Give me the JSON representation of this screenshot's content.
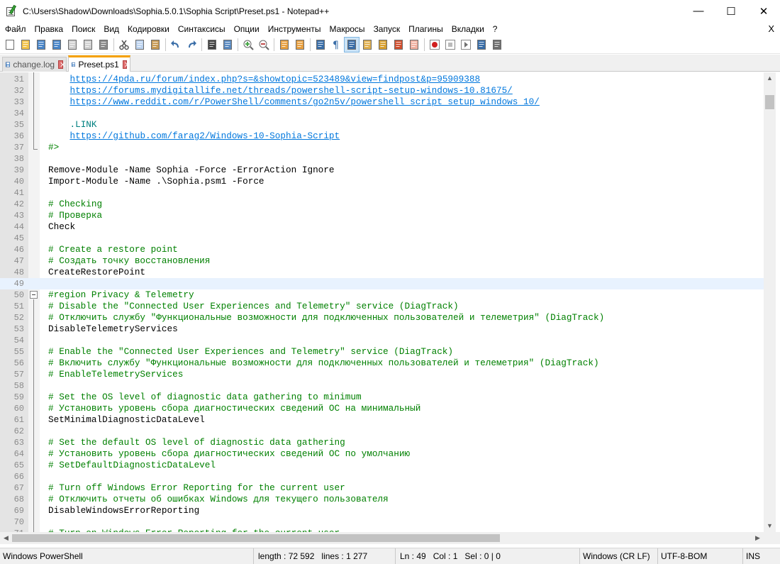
{
  "window": {
    "title": "C:\\Users\\Shadow\\Downloads\\Sophia.5.0.1\\Sophia Script\\Preset.ps1 - Notepad++",
    "minimize": "—",
    "maximize": "☐",
    "close": "✕"
  },
  "menu": {
    "items": [
      "Файл",
      "Правка",
      "Поиск",
      "Вид",
      "Кодировки",
      "Синтаксисы",
      "Опции",
      "Инструменты",
      "Макросы",
      "Запуск",
      "Плагины",
      "Вкладки",
      "?"
    ],
    "close_label": "X"
  },
  "toolbar": {
    "icons": [
      "new-file-icon",
      "open-file-icon",
      "save-icon",
      "save-all-icon",
      "close-icon",
      "close-all-icon",
      "print-icon",
      "cut-icon",
      "copy-icon",
      "paste-icon",
      "undo-icon",
      "redo-icon",
      "find-icon",
      "replace-icon",
      "zoom-in-icon",
      "zoom-out-icon",
      "sync-vertical-icon",
      "sync-horizontal-icon",
      "word-wrap-icon",
      "show-all-chars-icon",
      "indent-guide-icon",
      "doc-map-icon",
      "function-list-icon",
      "folder-workspace-icon",
      "monitoring-icon",
      "record-macro-icon",
      "stop-macro-icon",
      "play-macro-icon",
      "run-macro-multiple-icon",
      "save-macro-icon"
    ]
  },
  "tabs": [
    {
      "label": "change.log",
      "active": false
    },
    {
      "label": "Preset.ps1",
      "active": true
    }
  ],
  "editor": {
    "lines": [
      {
        "n": "31",
        "segs": [
          {
            "t": "    ",
            "c": "default"
          },
          {
            "t": "https://4pda.ru/forum/index.php?s=&showtopic=523489&view=findpost&p=95909388",
            "c": "url"
          }
        ]
      },
      {
        "n": "32",
        "segs": [
          {
            "t": "    ",
            "c": "default"
          },
          {
            "t": "https://forums.mydigitallife.net/threads/powershell-script-setup-windows-10.81675/",
            "c": "url"
          }
        ]
      },
      {
        "n": "33",
        "segs": [
          {
            "t": "    ",
            "c": "default"
          },
          {
            "t": "https://www.reddit.com/r/PowerShell/comments/go2n5v/powershell_script_setup_windows_10/",
            "c": "url"
          }
        ]
      },
      {
        "n": "34",
        "segs": []
      },
      {
        "n": "35",
        "segs": [
          {
            "t": "    ",
            "c": "default"
          },
          {
            "t": ".LINK",
            "c": "keyword"
          }
        ]
      },
      {
        "n": "36",
        "segs": [
          {
            "t": "    ",
            "c": "default"
          },
          {
            "t": "https://github.com/farag2/Windows-10-Sophia-Script",
            "c": "url"
          }
        ]
      },
      {
        "n": "37",
        "segs": [
          {
            "t": "#>",
            "c": "comment"
          }
        ]
      },
      {
        "n": "38",
        "segs": []
      },
      {
        "n": "39",
        "segs": [
          {
            "t": "Remove-Module -Name Sophia -Force -ErrorAction Ignore",
            "c": "default"
          }
        ]
      },
      {
        "n": "40",
        "segs": [
          {
            "t": "Import-Module -Name .\\Sophia.psm1 -Force",
            "c": "default"
          }
        ]
      },
      {
        "n": "41",
        "segs": []
      },
      {
        "n": "42",
        "segs": [
          {
            "t": "# Checking",
            "c": "comment"
          }
        ]
      },
      {
        "n": "43",
        "segs": [
          {
            "t": "# Проверка",
            "c": "comment"
          }
        ]
      },
      {
        "n": "44",
        "segs": [
          {
            "t": "Check",
            "c": "default"
          }
        ]
      },
      {
        "n": "45",
        "segs": []
      },
      {
        "n": "46",
        "segs": [
          {
            "t": "# Create a restore point",
            "c": "comment"
          }
        ]
      },
      {
        "n": "47",
        "segs": [
          {
            "t": "# Создать точку восстановления",
            "c": "comment"
          }
        ]
      },
      {
        "n": "48",
        "segs": [
          {
            "t": "CreateRestorePoint",
            "c": "default"
          }
        ]
      },
      {
        "n": "49",
        "segs": [],
        "current": true
      },
      {
        "n": "50",
        "segs": [
          {
            "t": "#region Privacy & Telemetry",
            "c": "comment"
          }
        ]
      },
      {
        "n": "51",
        "segs": [
          {
            "t": "# Disable the \"Connected User Experiences and Telemetry\" service (DiagTrack)",
            "c": "comment"
          }
        ]
      },
      {
        "n": "52",
        "segs": [
          {
            "t": "# Отключить службу \"Функциональные возможности для подключенных пользователей и телеметрия\" (DiagTrack)",
            "c": "comment"
          }
        ]
      },
      {
        "n": "53",
        "segs": [
          {
            "t": "DisableTelemetryServices",
            "c": "default"
          }
        ]
      },
      {
        "n": "54",
        "segs": []
      },
      {
        "n": "55",
        "segs": [
          {
            "t": "# Enable the \"Connected User Experiences and Telemetry\" service (DiagTrack)",
            "c": "comment"
          }
        ]
      },
      {
        "n": "56",
        "segs": [
          {
            "t": "# Включить службу \"Функциональные возможности для подключенных пользователей и телеметрия\" (DiagTrack)",
            "c": "comment"
          }
        ]
      },
      {
        "n": "57",
        "segs": [
          {
            "t": "# EnableTelemetryServices",
            "c": "comment"
          }
        ]
      },
      {
        "n": "58",
        "segs": []
      },
      {
        "n": "59",
        "segs": [
          {
            "t": "# Set the OS level of diagnostic data gathering to minimum",
            "c": "comment"
          }
        ]
      },
      {
        "n": "60",
        "segs": [
          {
            "t": "# Установить уровень сбора диагностических сведений ОС на минимальный",
            "c": "comment"
          }
        ]
      },
      {
        "n": "61",
        "segs": [
          {
            "t": "SetMinimalDiagnosticDataLevel",
            "c": "default"
          }
        ]
      },
      {
        "n": "62",
        "segs": []
      },
      {
        "n": "63",
        "segs": [
          {
            "t": "# Set the default OS level of diagnostic data gathering",
            "c": "comment"
          }
        ]
      },
      {
        "n": "64",
        "segs": [
          {
            "t": "# Установить уровень сбора диагностических сведений ОС по умолчанию",
            "c": "comment"
          }
        ]
      },
      {
        "n": "65",
        "segs": [
          {
            "t": "# SetDefaultDiagnosticDataLevel",
            "c": "comment"
          }
        ]
      },
      {
        "n": "66",
        "segs": []
      },
      {
        "n": "67",
        "segs": [
          {
            "t": "# Turn off Windows Error Reporting for the current user",
            "c": "comment"
          }
        ]
      },
      {
        "n": "68",
        "segs": [
          {
            "t": "# Отключить отчеты об ошибках Windows для текущего пользователя",
            "c": "comment"
          }
        ]
      },
      {
        "n": "69",
        "segs": [
          {
            "t": "DisableWindowsErrorReporting",
            "c": "default"
          }
        ]
      },
      {
        "n": "70",
        "segs": []
      },
      {
        "n": "71",
        "segs": [
          {
            "t": "# Turn on Windows Error Reporting for the current user",
            "c": "comment"
          }
        ]
      }
    ]
  },
  "status": {
    "language": "Windows PowerShell",
    "length": "length : 72 592",
    "lines": "lines : 1 277",
    "ln": "Ln : 49",
    "col": "Col : 1",
    "sel": "Sel : 0 | 0",
    "eol": "Windows (CR LF)",
    "encoding": "UTF-8-BOM",
    "mode": "INS"
  },
  "colors": {
    "comment": "#008000",
    "url": "#0077dd",
    "keyword": "#008080",
    "default": "#000000",
    "active_tab_accent": "#f5a100",
    "current_line": "#e8f2fe"
  }
}
